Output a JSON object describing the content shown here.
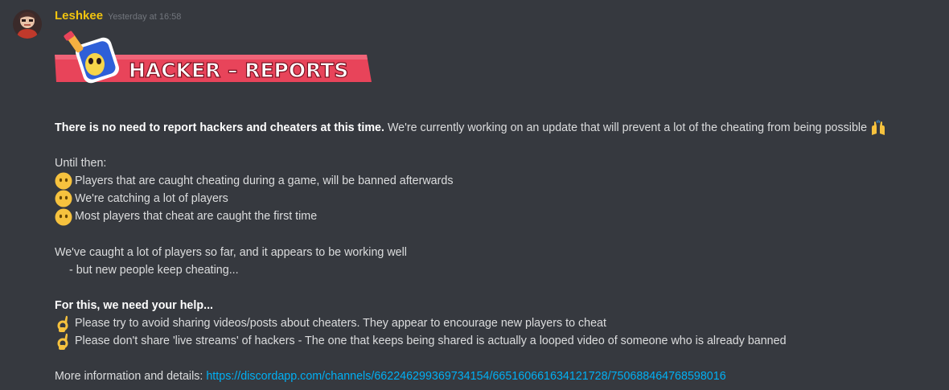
{
  "message": {
    "username": "Leshkee",
    "username_color": "#f1c40f",
    "timestamp": "Yesterday at 16:58",
    "avatar_icon": "avatar-image",
    "banner": {
      "text": "HACKER – REPORTS",
      "icon": "fall-guys-bean-icon",
      "color": "#e8445a"
    },
    "intro_bold": "There is no need to report hackers and cheaters at this time.",
    "intro_rest": " We're currently working on an update that will prevent a lot of the cheating from being possible",
    "intro_emoji": "raised-hands-emoji",
    "until_then": "Until then:",
    "bullets_a": [
      {
        "emoji": "face-without-mouth-emoji",
        "text": "Players that are caught cheating during a game, will be banned afterwards"
      },
      {
        "emoji": "face-without-mouth-emoji",
        "text": "We're catching a lot of players"
      },
      {
        "emoji": "face-without-mouth-emoji",
        "text": "Most players that cheat are caught the first time"
      }
    ],
    "caught_line": "We've caught a lot of players so far, and it appears to be working well",
    "caught_sub": "- but new people keep cheating...",
    "help_heading": "For this, we need your help...",
    "bullets_b": [
      {
        "emoji": "ok-hand-emoji",
        "text": "Please try to avoid sharing videos/posts about cheaters. They appear to encourage new players to cheat"
      },
      {
        "emoji": "ok-hand-emoji",
        "text": "Please don't share 'live streams' of hackers - The one that keeps being shared is actually a looped video of someone who is already banned"
      }
    ],
    "more_info_label": "More information and details: ",
    "more_info_link": "https://discordapp.com/channels/662246299369734154/665160661634121728/750688464768598016",
    "link_color": "#00b0f4"
  }
}
